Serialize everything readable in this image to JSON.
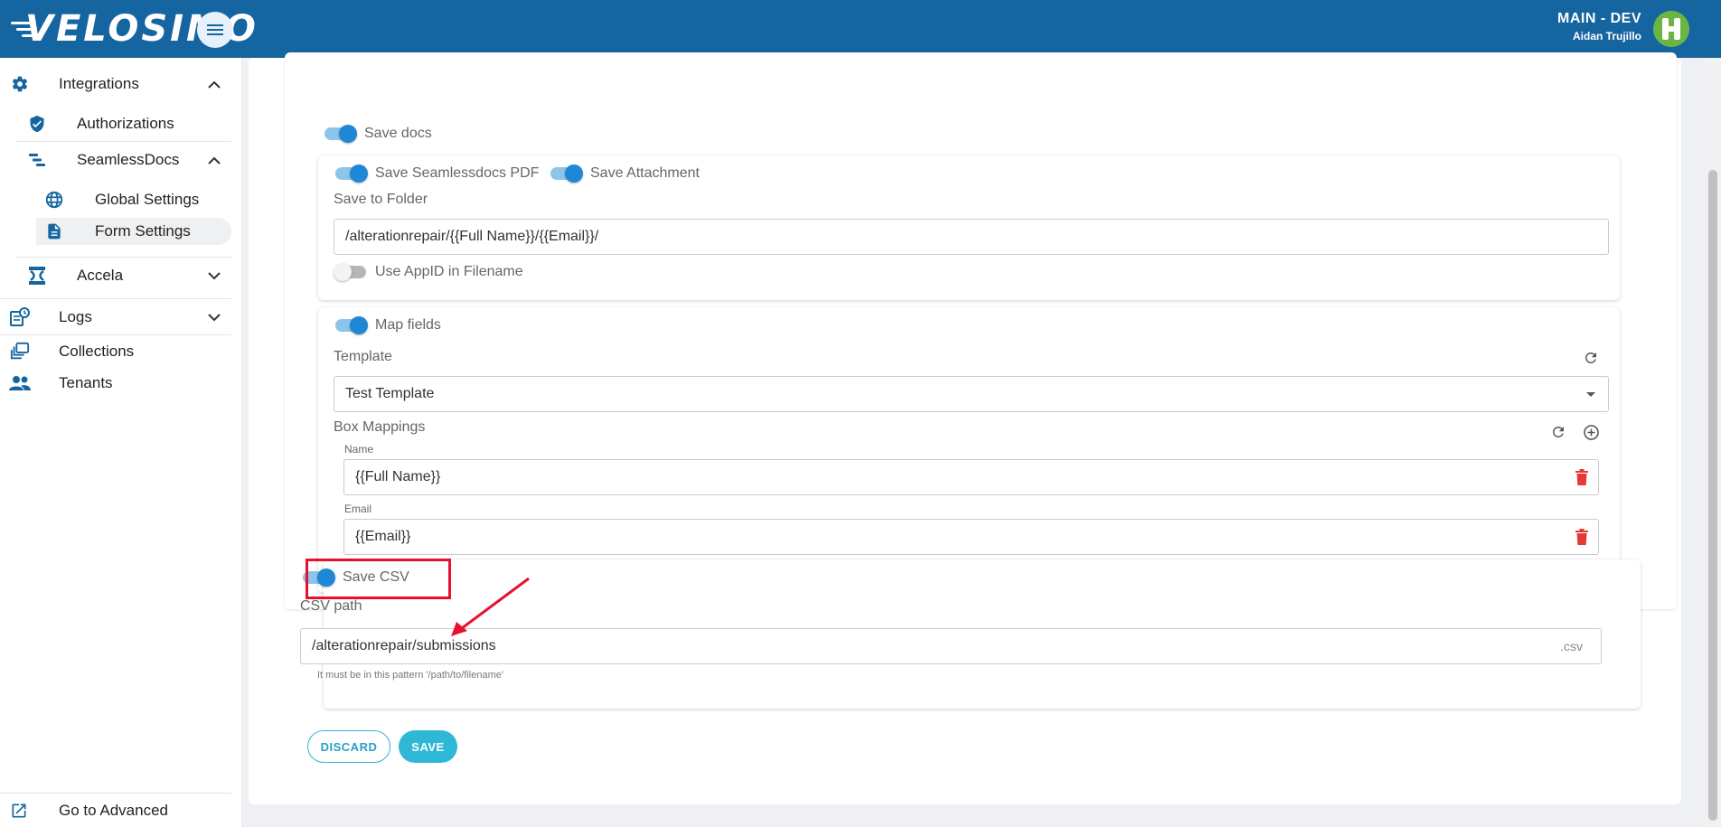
{
  "header": {
    "logo_text": "VELOSIMO",
    "env_name": "MAIN - DEV",
    "user_name": "Aidan Trujillo"
  },
  "sidebar": {
    "integrations": "Integrations",
    "authorizations": "Authorizations",
    "seamlessdocs": "SeamlessDocs",
    "global_settings": "Global Settings",
    "form_settings": "Form Settings",
    "accela": "Accela",
    "logs": "Logs",
    "collections": "Collections",
    "tenants": "Tenants",
    "go_advanced": "Go to Advanced"
  },
  "form": {
    "save_docs_label": "Save docs",
    "save_docs_on": true,
    "save_pdf_label": "Save Seamlessdocs PDF",
    "save_attachment_label": "Save Attachment",
    "save_to_folder_label": "Save to Folder",
    "save_to_folder_value": "/alterationrepair/{{Full Name}}/{{Email}}/",
    "use_appid_label": "Use AppID in Filename",
    "use_appid_on": false,
    "map_fields_label": "Map fields",
    "template_label": "Template",
    "template_value": "Test Template",
    "box_mappings_label": "Box Mappings",
    "mappings": [
      {
        "label": "Name",
        "value": "{{Full Name}}"
      },
      {
        "label": "Email",
        "value": "{{Email}}"
      }
    ],
    "save_csv_label": "Save CSV",
    "csv_path_label": "CSV path",
    "csv_path_value": "/alterationrepair/submissions",
    "csv_suffix": ".csv",
    "csv_hint": "It must be in this pattern '/path/to/filename'",
    "discard_label": "DISCARD",
    "save_label": "SAVE"
  },
  "colors": {
    "topbar": "#1565a0",
    "accent": "#1e88d6",
    "save_button": "#2fb8d6",
    "delete_icon": "#e53935",
    "highlight": "#e8112d"
  }
}
